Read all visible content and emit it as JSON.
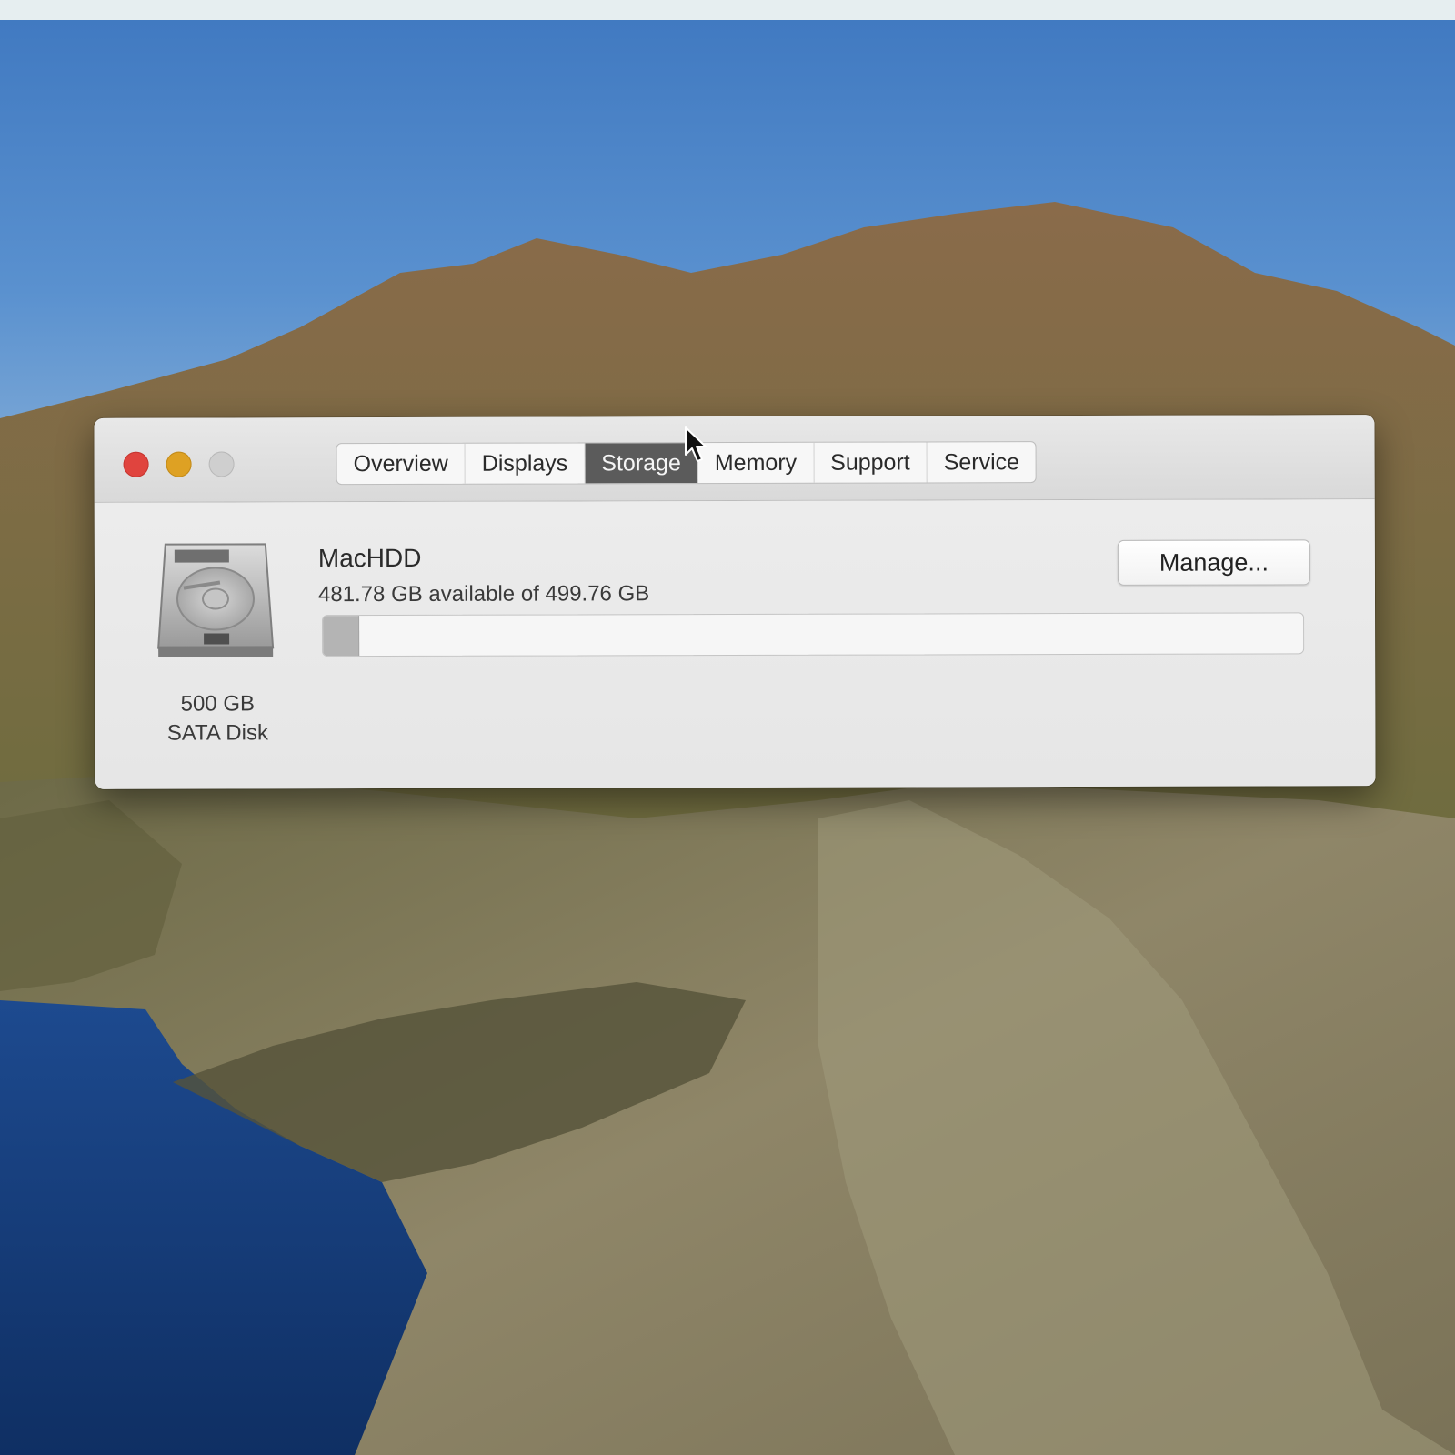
{
  "window": {
    "tabs": [
      {
        "label": "Overview"
      },
      {
        "label": "Displays"
      },
      {
        "label": "Storage"
      },
      {
        "label": "Memory"
      },
      {
        "label": "Support"
      },
      {
        "label": "Service"
      }
    ],
    "active_tab": "Storage"
  },
  "storage": {
    "disk_size": "500 GB",
    "disk_type": "SATA Disk",
    "volume_name": "MacHDD",
    "available_text": "481.78 GB available of 499.76 GB",
    "used_fraction": 0.036,
    "manage_label": "Manage..."
  },
  "colors": {
    "close": "#e0443e",
    "minimize": "#dea123",
    "zoom": "#cfcfcf",
    "active_tab_bg": "#5b5b5b"
  },
  "icons": [
    "close-icon",
    "minimize-icon",
    "zoom-icon",
    "hard-disk-icon",
    "pointer-cursor-icon"
  ]
}
